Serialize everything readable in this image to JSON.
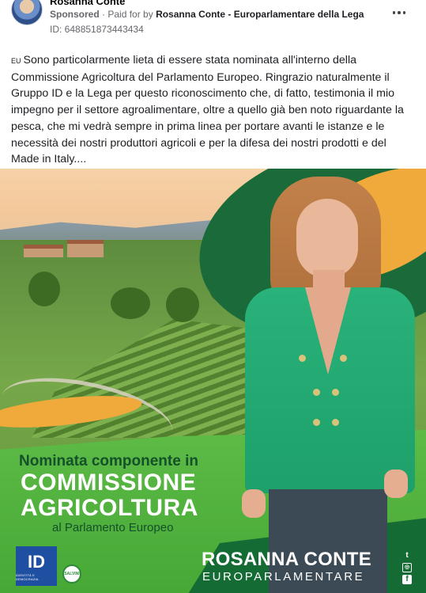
{
  "header": {
    "page_name": "Rosanna Conte",
    "sponsored_label": "Sponsored",
    "paid_for_prefix": "· Paid for by",
    "payer": "Rosanna Conte - Europarlamentare della Lega",
    "ad_id": "ID: 648851873443434",
    "more_icon": "more-horizontal-icon"
  },
  "post": {
    "flag_label": "EU",
    "text": "Sono particolarmente lieta di essere stata nominata all'interno della Commissione Agricoltura del Parlamento Europeo. Ringrazio naturalmente il Gruppo ID e la Lega per questo riconoscimento che, di fatto, testimonia il mio impegno per il settore agroalimentare, oltre a quello già ben noto riguardante la pesca, che mi vedrà sempre in prima linea per portare avanti le istanze e le necessità dei nostri produttori agricoli e per la difesa dei nostri prodotti e del Made in Italy...."
  },
  "creative": {
    "line1": "Nominata componente in",
    "line2": "COMMISSIONE",
    "line3": "AGRICOLTURA",
    "line4": "al Parlamento Europeo",
    "party_logo_text": "ID",
    "party_logo_sub": "IDENTITÀ E DEMOCRAZIA",
    "lega_logo_text": "SALVINI",
    "name": "ROSANNA CONTE",
    "role": "EUROPARLAMENTARE",
    "social_icons": [
      "twitter-icon",
      "instagram-icon",
      "facebook-icon"
    ],
    "colors": {
      "dark_green": "#146c34",
      "light_green": "#5dbb46",
      "orange": "#f0a93b",
      "jacket_green": "#29b27a",
      "id_blue": "#1f4fa0"
    }
  }
}
